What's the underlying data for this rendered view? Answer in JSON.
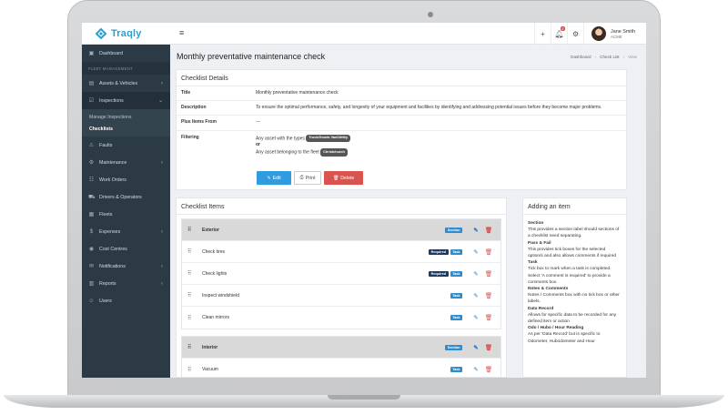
{
  "app": {
    "brand": "Traqly",
    "menu_toggle": "≡"
  },
  "sidebar": {
    "items": [
      {
        "label": "Dashboard",
        "icon": "▣"
      },
      {
        "label": "FLEET MANAGEMENT"
      },
      {
        "label": "Assets & Vehicles",
        "icon": "▤"
      },
      {
        "label": "Inspections",
        "icon": "☑"
      },
      {
        "label": "Faults",
        "icon": "⚠"
      },
      {
        "label": "Maintenance",
        "icon": "⚙"
      },
      {
        "label": "Work Orders",
        "icon": "☷"
      },
      {
        "label": "Drivers & Operators",
        "icon": "⛟"
      },
      {
        "label": "Fleets",
        "icon": "▦"
      },
      {
        "label": "Expenses",
        "icon": "$"
      },
      {
        "label": "Cost Centres",
        "icon": "◉"
      },
      {
        "label": "Notifications",
        "icon": "✉"
      },
      {
        "label": "Reports",
        "icon": "▥"
      },
      {
        "label": "Users",
        "icon": "☺"
      }
    ],
    "sub_items": [
      "Manage Inspections",
      "Checklists"
    ]
  },
  "topbar": {
    "plus": "+",
    "notif_count": "2",
    "user_name": "Jane Smith",
    "user_org": "ACME"
  },
  "page": {
    "title": "Monthly preventative maintenance check",
    "breadcrumb": [
      "Dashboard",
      "Check List",
      "View"
    ]
  },
  "details": {
    "heading": "Checklist Details",
    "title_label": "Title",
    "title_value": "Monthly preventative maintenance check",
    "desc_label": "Description",
    "desc_value": "To ensure the optimal performance, safety, and longevity of your equipment and facilities by identifying and addressing potential issues before they become major problems.",
    "plus_label": "Plus Items From",
    "plus_value": "---",
    "filter_label": "Filtering",
    "filter_types": "Any asset with the types",
    "filter_type_pill": "Truck/Goods Van/Utility",
    "filter_or": "or",
    "filter_fleet": "Any asset belonging to the fleet",
    "filter_fleet_pill": "Christchurch",
    "btn_edit": "Edit",
    "btn_print": "Print",
    "btn_delete": "Delete"
  },
  "items": {
    "heading": "Checklist Items",
    "groups": [
      {
        "section": "Exterior",
        "rows": [
          {
            "name": "Check tires",
            "required": true
          },
          {
            "name": "Check lights",
            "required": true
          },
          {
            "name": "Inspect windshield",
            "required": false
          },
          {
            "name": "Clean mirrors",
            "required": false
          }
        ]
      },
      {
        "section": "Interior",
        "rows": [
          {
            "name": "Vacuum",
            "required": false
          }
        ]
      }
    ],
    "tag_section": "Section",
    "tag_task": "Task",
    "tag_required": "Required"
  },
  "help": {
    "heading": "Adding an item",
    "entries": [
      {
        "h": "Section",
        "t": "This provides a section label should sections of a checklist need separating."
      },
      {
        "h": "Pass & Fail",
        "t": "This provides tick boxes for the selected option/s and also allows comments if required"
      },
      {
        "h": "Task",
        "t": "Tick box to mark when a task is completed. Select 'A comment is required' to provide a comments box."
      },
      {
        "h": "Notes & Comments",
        "t": "Notes / Comments box with no tick box or other labels."
      },
      {
        "h": "Data Record",
        "t": "Allows for specific data to be recorded for any defined item or action"
      },
      {
        "h": "Odo / Hubo / Hour Reading",
        "t": "As per 'Data Record' but is specific to Odometer, Hubodometer and Hour"
      }
    ]
  },
  "colors": {
    "sidebar": "#2b3a44",
    "accent": "#2e9cde",
    "danger": "#d9534f",
    "required": "#1f3a60",
    "section_bg": "#d9d9d9"
  }
}
